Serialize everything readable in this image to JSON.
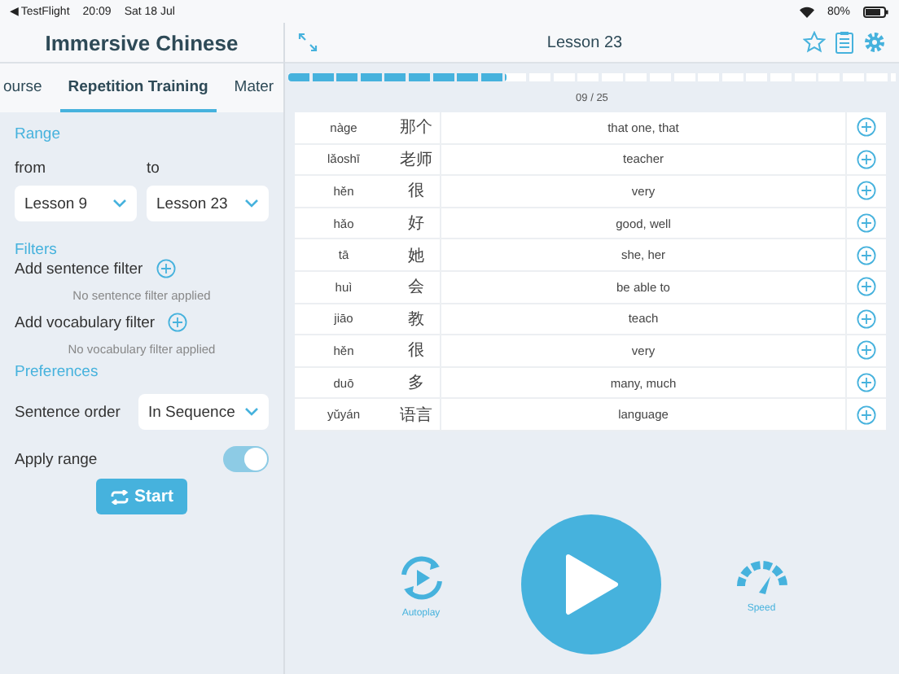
{
  "status_bar": {
    "back": "◀ TestFlight",
    "time": "20:09",
    "date": "Sat 18 Jul",
    "battery": "80%"
  },
  "sidebar": {
    "title": "Immersive Chinese",
    "tabs": [
      {
        "label": "ourse",
        "selected": false
      },
      {
        "label": "Repetition Training",
        "selected": true
      },
      {
        "label": "Mater",
        "selected": false
      }
    ],
    "range": {
      "heading": "Range",
      "from_label": "from",
      "to_label": "to",
      "from": "Lesson 9",
      "to": "Lesson 23"
    },
    "filters": {
      "heading": "Filters",
      "sentence_label": "Add sentence filter",
      "sentence_empty": "No sentence filter applied",
      "vocab_label": "Add vocabulary filter",
      "vocab_empty": "No vocabulary filter applied"
    },
    "preferences": {
      "heading": "Preferences",
      "order_label": "Sentence order",
      "order": "In Sequence",
      "apply_label": "Apply range",
      "apply_on": true
    },
    "start": "Start"
  },
  "main": {
    "title": "Lesson 23",
    "progress": {
      "level": 0.36,
      "count": "09 / 25"
    },
    "rows": [
      {
        "pinyin": "nàge",
        "hanzi": "那个",
        "meaning": "that one, that"
      },
      {
        "pinyin": "lǎoshī",
        "hanzi": "老师",
        "meaning": "teacher"
      },
      {
        "pinyin": "hěn",
        "hanzi": "很",
        "meaning": "very"
      },
      {
        "pinyin": "hǎo",
        "hanzi": "好",
        "meaning": "good, well"
      },
      {
        "pinyin": "tā",
        "hanzi": "她",
        "meaning": "she, her"
      },
      {
        "pinyin": "huì",
        "hanzi": "会",
        "meaning": "be able to"
      },
      {
        "pinyin": "jiāo",
        "hanzi": "教",
        "meaning": "teach"
      },
      {
        "pinyin": "hěn",
        "hanzi": "很",
        "meaning": "very"
      },
      {
        "pinyin": "duō",
        "hanzi": "多",
        "meaning": "many, much"
      },
      {
        "pinyin": "yǔyán",
        "hanzi": "语言",
        "meaning": "language"
      }
    ],
    "controls": {
      "autoplay": "Autoplay",
      "speed": "Speed"
    }
  }
}
